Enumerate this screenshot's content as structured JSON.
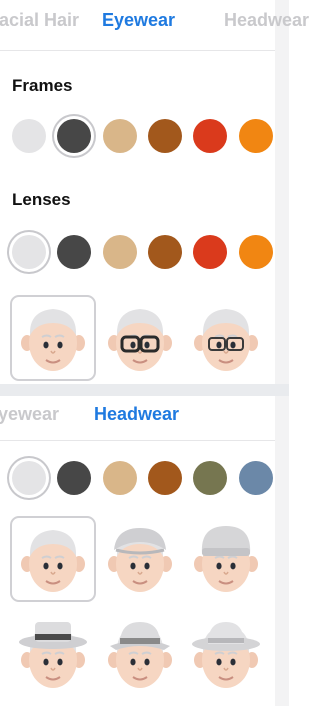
{
  "top_tabs": [
    "Facial Hair",
    "Eyewear",
    "Headwear"
  ],
  "top_active": "Eyewear",
  "frames_heading": "Frames",
  "lenses_heading": "Lenses",
  "frame_colors": [
    "#e4e4e6",
    "#474747",
    "#d9b689",
    "#a2581c",
    "#da3a1c",
    "#f18612"
  ],
  "lens_colors": [
    "#e4e4e6",
    "#474747",
    "#d9b689",
    "#a2581c",
    "#da3a1c",
    "#f18612"
  ],
  "eyewear_styles": [
    "none",
    "thick-frames",
    "thin-frames"
  ],
  "bottom_tabs": [
    "Eyewear",
    "Headwear"
  ],
  "bottom_active": "Headwear",
  "hat_colors": [
    "#e4e4e6",
    "#474747",
    "#d9b689",
    "#a2581c",
    "#767650",
    "#6b88a8"
  ],
  "headwear_styles": [
    "none",
    "flat-cap",
    "beanie",
    "porkpie",
    "bucket-hat",
    "sun-hat"
  ]
}
